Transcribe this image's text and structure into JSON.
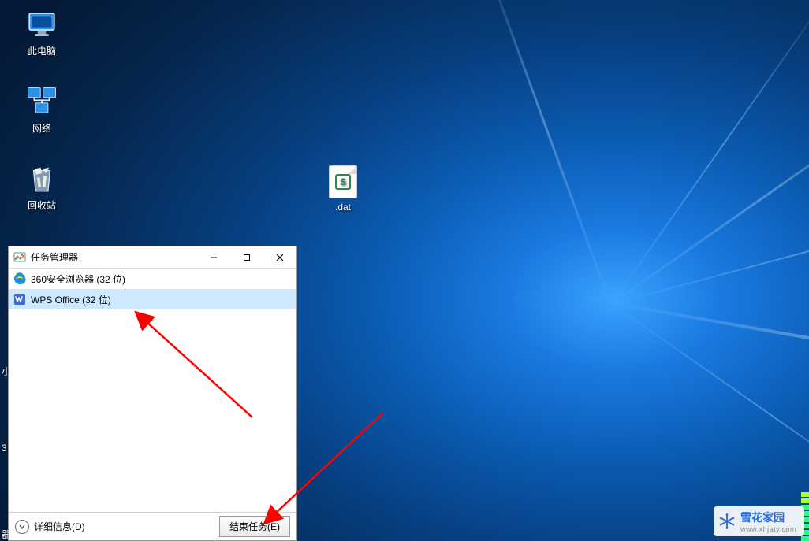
{
  "desktop": {
    "icons": [
      {
        "name": "此电脑"
      },
      {
        "name": "网络"
      },
      {
        "name": "回收站"
      }
    ],
    "file": {
      "name": ".dat",
      "badge": "S"
    },
    "partial_labels": {
      "left1": "小",
      "left2": "3",
      "left3": "器"
    }
  },
  "taskmgr": {
    "title": "任务管理器",
    "processes": [
      {
        "name": "360安全浏览器 (32 位)",
        "selected": false,
        "icon": "ie"
      },
      {
        "name": "WPS Office (32 位)",
        "selected": true,
        "icon": "wps"
      }
    ],
    "details_label": "详细信息(D)",
    "end_task_label": "结束任务(E)"
  },
  "watermark": {
    "name": "雪花家园",
    "sub": "www.xhjaty.com"
  }
}
